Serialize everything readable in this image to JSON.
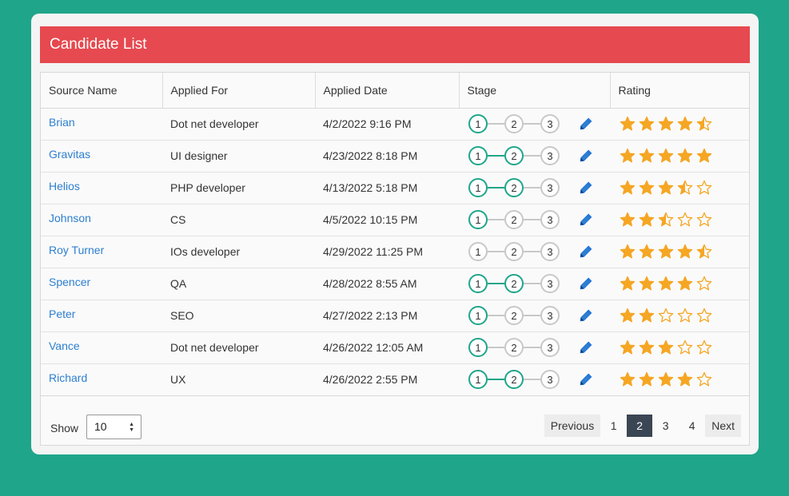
{
  "title": "Candidate List",
  "columns": [
    "Source Name",
    "Applied For",
    "Applied Date",
    "Stage",
    "Rating"
  ],
  "rows": [
    {
      "name": "Brian",
      "role": "Dot net developer",
      "date": "4/2/2022 9:16 PM",
      "stage": 1,
      "rating": 4.5
    },
    {
      "name": "Gravitas",
      "role": "UI designer",
      "date": "4/23/2022 8:18 PM",
      "stage": 2,
      "rating": 5
    },
    {
      "name": "Helios",
      "role": "PHP developer",
      "date": "4/13/2022 5:18 PM",
      "stage": 2,
      "rating": 3.5
    },
    {
      "name": "Johnson",
      "role": "CS",
      "date": "4/5/2022 10:15 PM",
      "stage": 1,
      "rating": 2.5
    },
    {
      "name": "Roy Turner",
      "role": "IOs developer",
      "date": "4/29/2022 11:25 PM",
      "stage": 0,
      "rating": 4.5
    },
    {
      "name": "Spencer",
      "role": "QA",
      "date": "4/28/2022 8:55 AM",
      "stage": 2,
      "rating": 4
    },
    {
      "name": "Peter",
      "role": "SEO",
      "date": "4/27/2022 2:13 PM",
      "stage": 1,
      "rating": 2
    },
    {
      "name": "Vance",
      "role": "Dot net developer",
      "date": "4/26/2022 12:05 AM",
      "stage": 1,
      "rating": 3
    },
    {
      "name": "Richard",
      "role": "UX",
      "date": "4/26/2022 2:55 PM",
      "stage": 2,
      "rating": 4
    }
  ],
  "stage_steps": [
    "1",
    "2",
    "3"
  ],
  "footer": {
    "show_label": "Show",
    "page_size": "10",
    "previous": "Previous",
    "next": "Next",
    "pages": [
      "1",
      "2",
      "3",
      "4"
    ],
    "current_page": "2"
  },
  "colors": {
    "header": "#e6494f",
    "background": "#1fa58a",
    "link": "#2d7fd0",
    "star": "#f5a623",
    "stage_done": "#1fa58a",
    "active_page": "#3a4653"
  },
  "icons": {
    "edit": "pencil-icon",
    "rating": "star-icon"
  }
}
